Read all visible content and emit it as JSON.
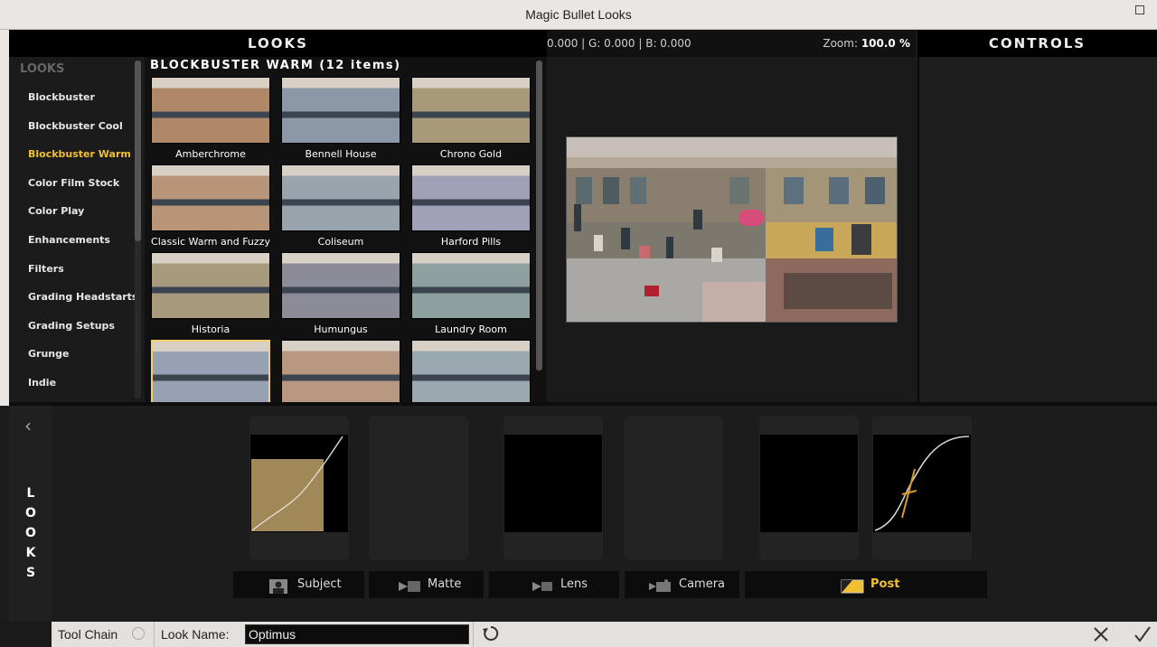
{
  "window": {
    "title": "Magic Bullet Looks"
  },
  "headers": {
    "looks": "LOOKS",
    "controls": "CONTROLS"
  },
  "info_bar": {
    "rgb": "0.000 | G: 0.000 | B: 0.000",
    "zoom_label": "Zoom:",
    "zoom_value": "100.0 %"
  },
  "categories": {
    "heading": "LOOKS",
    "items": [
      {
        "label": "Blockbuster",
        "active": false
      },
      {
        "label": "Blockbuster Cool",
        "active": false
      },
      {
        "label": "Blockbuster Warm",
        "active": true
      },
      {
        "label": "Color Film Stock",
        "active": false
      },
      {
        "label": "Color Play",
        "active": false
      },
      {
        "label": "Enhancements",
        "active": false
      },
      {
        "label": "Filters",
        "active": false
      },
      {
        "label": "Grading Headstarts",
        "active": false
      },
      {
        "label": "Grading Setups",
        "active": false
      },
      {
        "label": "Grunge",
        "active": false
      },
      {
        "label": "Indie",
        "active": false
      }
    ]
  },
  "grid": {
    "title": "BLOCKBUSTER WARM (12 items)",
    "items": [
      {
        "label": "Amberchrome",
        "tint": "#b08868"
      },
      {
        "label": "Bennell House",
        "tint": "#8a98a8"
      },
      {
        "label": "Chrono Gold",
        "tint": "#a89a78"
      },
      {
        "label": "Classic Warm and Fuzzy",
        "tint": "#b89478"
      },
      {
        "label": "Coliseum",
        "tint": "#9aa4ac"
      },
      {
        "label": "Harford Pills",
        "tint": "#a0a0b8"
      },
      {
        "label": "Historia",
        "tint": "#a89a7c"
      },
      {
        "label": "Humungus",
        "tint": "#8c8c98"
      },
      {
        "label": "Laundry Room",
        "tint": "#8ea0a0"
      },
      {
        "label": "",
        "tint": "#98a0b4",
        "selected": true
      },
      {
        "label": "",
        "tint": "#b89880"
      },
      {
        "label": "",
        "tint": "#9aa8b0"
      }
    ]
  },
  "toolchain": {
    "tabs": [
      {
        "label": "Subject",
        "icon": "subject-icon"
      },
      {
        "label": "Matte",
        "icon": "matte-icon"
      },
      {
        "label": "Lens",
        "icon": "lens-icon"
      },
      {
        "label": "Camera",
        "icon": "camera-icon"
      },
      {
        "label": "Post",
        "icon": "post-icon",
        "active": true
      }
    ],
    "side_label": "LOOKS"
  },
  "status": {
    "tool_chain": "Tool Chain",
    "look_name_label": "Look Name:",
    "look_name_value": "Optimus"
  },
  "colors": {
    "accent": "#f0c030",
    "curve_fill": "#a08858"
  }
}
